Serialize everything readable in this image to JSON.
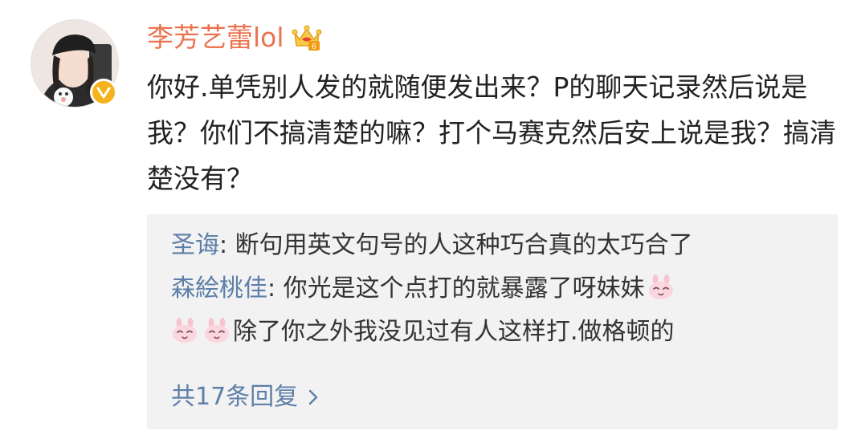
{
  "post": {
    "username": "李芳艺蕾lol",
    "text": "你好.单凭别人发的就随便发出来？P的聊天记录然后说是我？你们不搞清楚的嘛？打个马赛克然后安上说是我？搞清楚没有？"
  },
  "replies": [
    {
      "author": "圣诲",
      "separator": ": ",
      "text": "断句用英文句号的人这种巧合真的太巧合了"
    },
    {
      "author": "森絵桃佳",
      "separator": ": ",
      "text_part1": "你光是这个点打的就暴露了呀妹妹",
      "text_part2": "除了你之外我没见过有人这样打.做格顿的"
    }
  ],
  "more_replies_label": "共17条回复",
  "icons": {
    "vip": "crown-icon",
    "verified": "verified-v-icon",
    "emoji": "bunny-emoji-icon",
    "chevron": "chevron-right-icon"
  },
  "colors": {
    "username": "#eb7350",
    "reply_author": "#5d7fa8",
    "reply_background": "#f2f2f2",
    "verified": "#f6b21b"
  }
}
